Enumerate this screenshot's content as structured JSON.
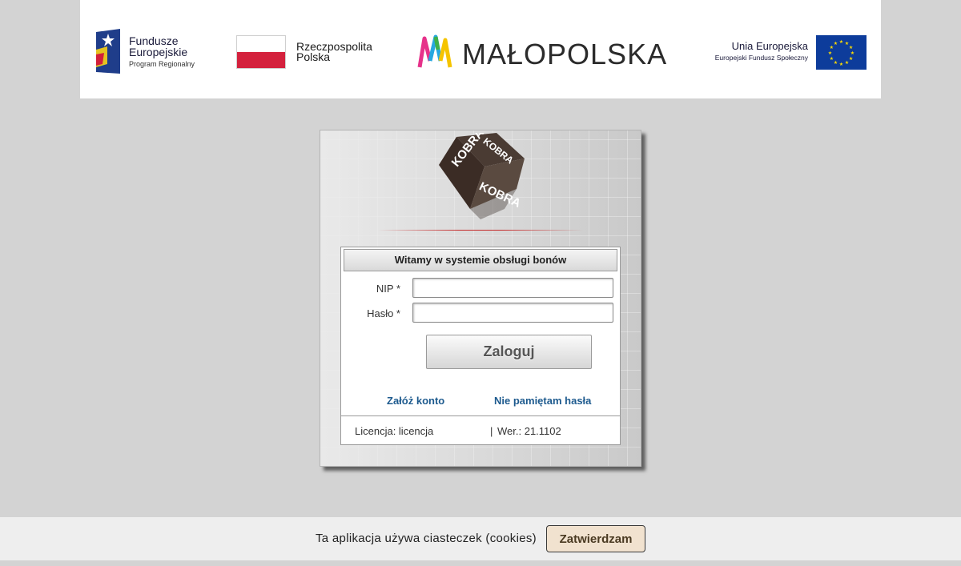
{
  "header": {
    "fe_logo": {
      "line1": "Fundusze",
      "line2": "Europejskie",
      "line3": "Program Regionalny"
    },
    "rp_logo": {
      "line1": "Rzeczpospolita",
      "line2": "Polska"
    },
    "mp_logo": {
      "text": "MAŁOPOLSKA"
    },
    "eu_logo": {
      "line1": "Unia Europejska",
      "line2": "Europejski Fundusz Społeczny"
    }
  },
  "login": {
    "cube_text": "KOBRA",
    "heading": "Witamy w systemie obsługi bonów",
    "nip_label": "NIP *",
    "password_label": "Hasło *",
    "nip_value": "",
    "password_value": "",
    "submit_label": "Zaloguj",
    "register_link": "Załóż konto",
    "forgot_link": "Nie pamiętam hasła",
    "license": "Licencja: licencja",
    "separator": "|",
    "version": "Wer.: 21.1102"
  },
  "cookie": {
    "text": "Ta aplikacja używa ciasteczek (cookies)",
    "button": "Zatwierdzam"
  },
  "colors": {
    "background": "#d3d3d3",
    "link": "#1d5a8e",
    "poland_red": "#d4213d",
    "eu_blue": "#0d3c9b",
    "eu_star": "#ffdd00",
    "cookie_button_bg": "#f1e2cf"
  }
}
